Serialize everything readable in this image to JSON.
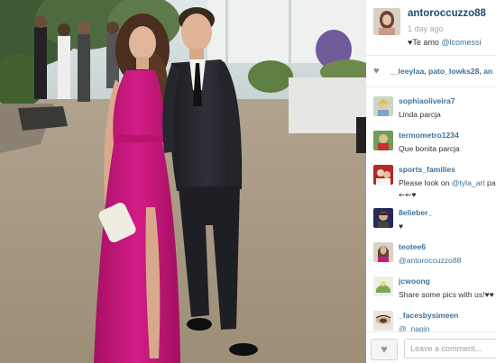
{
  "post": {
    "username": "antoroccuzzo88",
    "time_ago": "1 day ago",
    "caption_prefix": "♥Te amo ",
    "caption_mention": "@lcomessi"
  },
  "likes": {
    "text": "__leeylaa, pato_lowks28, an"
  },
  "comments": [
    {
      "username": "sophiaoliveira7",
      "text": "Linda parcja"
    },
    {
      "username": "termometro1234",
      "text": "Que bonita parcja"
    },
    {
      "username": "sports_families",
      "text": "Please look on ",
      "mention": "@tyla_art",
      "suffix": " pag",
      "line2": "⇜⇜♥"
    },
    {
      "username": "8elieber_",
      "text": "♥"
    },
    {
      "username": "teotee6",
      "mention": "@antoroccuzzo88"
    },
    {
      "username": "jcwoong",
      "text": "Share some pics with us!♥♥"
    },
    {
      "username": "_facesbysimeen",
      "mention": "@_nagin"
    }
  ],
  "footer": {
    "like_icon": "heart-icon",
    "comment_placeholder": "Leave a comment..."
  },
  "colors": {
    "username": "#1c4c74",
    "link": "#3f729b",
    "dress": "#c8187a"
  }
}
